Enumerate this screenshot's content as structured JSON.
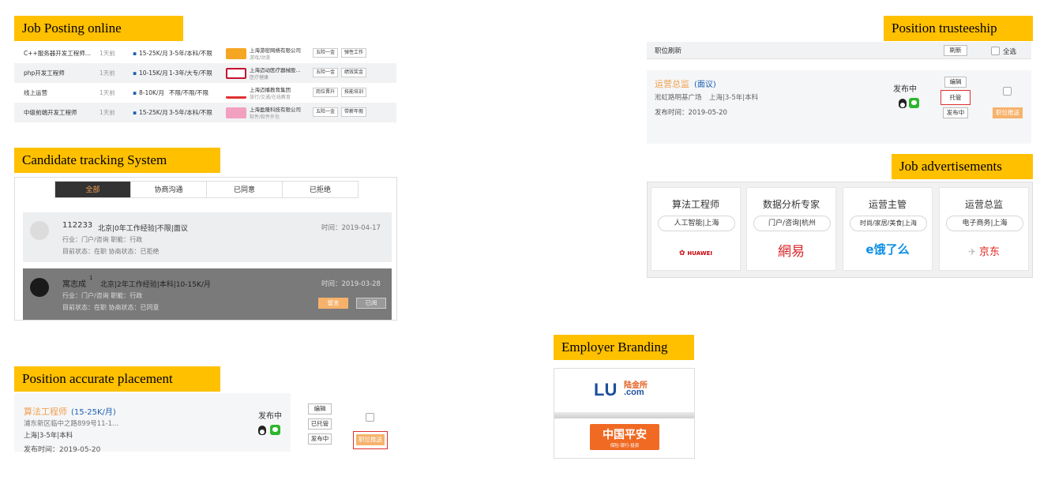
{
  "sections": {
    "job_posting": "Job Posting online",
    "trusteeship": "Position trusteeship",
    "candidate_tracking": "Candidate tracking System",
    "job_ads": "Job advertisements",
    "employer_branding": "Employer Branding",
    "accurate_placement": "Position accurate placement"
  },
  "job_posting": {
    "rows": [
      {
        "title": "C++服务器开发工程师...",
        "time": "1天前",
        "salary": "15-25K/月",
        "req": "3-5年/本科/不限",
        "company": "上海游密网络有限公司",
        "industry": "游戏/动漫",
        "tag1": "五险一金",
        "tag2": "弹性工作",
        "logo_color": "#f5a623"
      },
      {
        "title": "php开发工程师",
        "time": "1天前",
        "salary": "10-15K/月",
        "req": "1-3年/大专/不限",
        "company": "上海迈动医疗器械股...",
        "industry": "医疗健康",
        "tag1": "五险一金",
        "tag2": "绩效奖金",
        "logo_color": "#c41230"
      },
      {
        "title": "线上运营",
        "time": "1天前",
        "salary": "8-10K/月",
        "req": "不限/不限/不限",
        "company": "上海迈播教育集团",
        "industry": "旅行/交通/在线教育",
        "tag1": "岗位晋升",
        "tag2": "技能培训",
        "logo_color": "#e03030"
      },
      {
        "title": "中级前端开发工程师",
        "time": "1天前",
        "salary": "15-25K/月",
        "req": "3-5年/本科/不限",
        "company": "上海盈隆科技有限公司",
        "industry": "软件/软件外包",
        "tag1": "五险一金",
        "tag2": "带薪年假",
        "logo_color": "#f2a0c0"
      }
    ]
  },
  "trusteeship": {
    "header_left": "职位刷新",
    "refresh": "刷新",
    "select_all": "全选",
    "job_title": "运营总监",
    "negotiable": "(面议)",
    "address": "淞虹路明基广场",
    "meta": "上海|3-5年|本科",
    "publish_date": "发布时间：2019-05-20",
    "status": "发布中",
    "edit": "编辑",
    "entrust": "托管",
    "publishing": "发布中",
    "refresh_job": "职位推送"
  },
  "candidate_tracking": {
    "tabs": [
      "全部",
      "协商沟通",
      "已同意",
      "已拒绝"
    ],
    "cards": [
      {
        "name": "112233",
        "info": "北京|0年工作经验|不限|面议",
        "time": "时间：2019-04-17",
        "industry": "行业：门户/咨询   职能：行政",
        "status": "目前状态：在职   协商状态：已拒绝"
      },
      {
        "name": "寓志成",
        "sup": "1",
        "info": "北京|2年工作经验|本科|10-15K/月",
        "time": "时间：2019-03-28",
        "industry": "行业：门户/咨询   职能：行政",
        "status": "目前状态：在职   协商状态：已同意",
        "btn1": "留言",
        "btn2": "已阅"
      }
    ]
  },
  "job_ads": {
    "cards": [
      {
        "title": "算法工程师",
        "tag": "人工智能|上海",
        "logo": "HUAWEI",
        "logo_color": "#c7000b"
      },
      {
        "title": "数据分析专家",
        "tag": "门户/咨询|杭州",
        "logo": "網易",
        "logo_color": "#d8262b"
      },
      {
        "title": "运营主管",
        "tag": "时尚/家居/美食|上海",
        "logo": "e饿了么",
        "logo_color": "#0d8fe4"
      },
      {
        "title": "运营总监",
        "tag": "电子商务|上海",
        "logo": "京东",
        "logo_color": "#e1251b"
      }
    ]
  },
  "employer_branding": {
    "brand1": "LU",
    "brand1_cn": "陆金所",
    "brand1_com": ".com",
    "brand2": "中国平安",
    "brand2_sub": "保险·银行·投资"
  },
  "accurate_placement": {
    "job_title": "算法工程师",
    "salary": "(15-25K/月)",
    "address": "浦东新区临中之路899号11-1...",
    "meta": "上海|3-5年|本科",
    "publish_date": "发布时间：2019-05-20",
    "status": "发布中",
    "edit": "编辑",
    "entrusted": "已托管",
    "publishing": "发布中",
    "refresh_job": "职位推送"
  }
}
